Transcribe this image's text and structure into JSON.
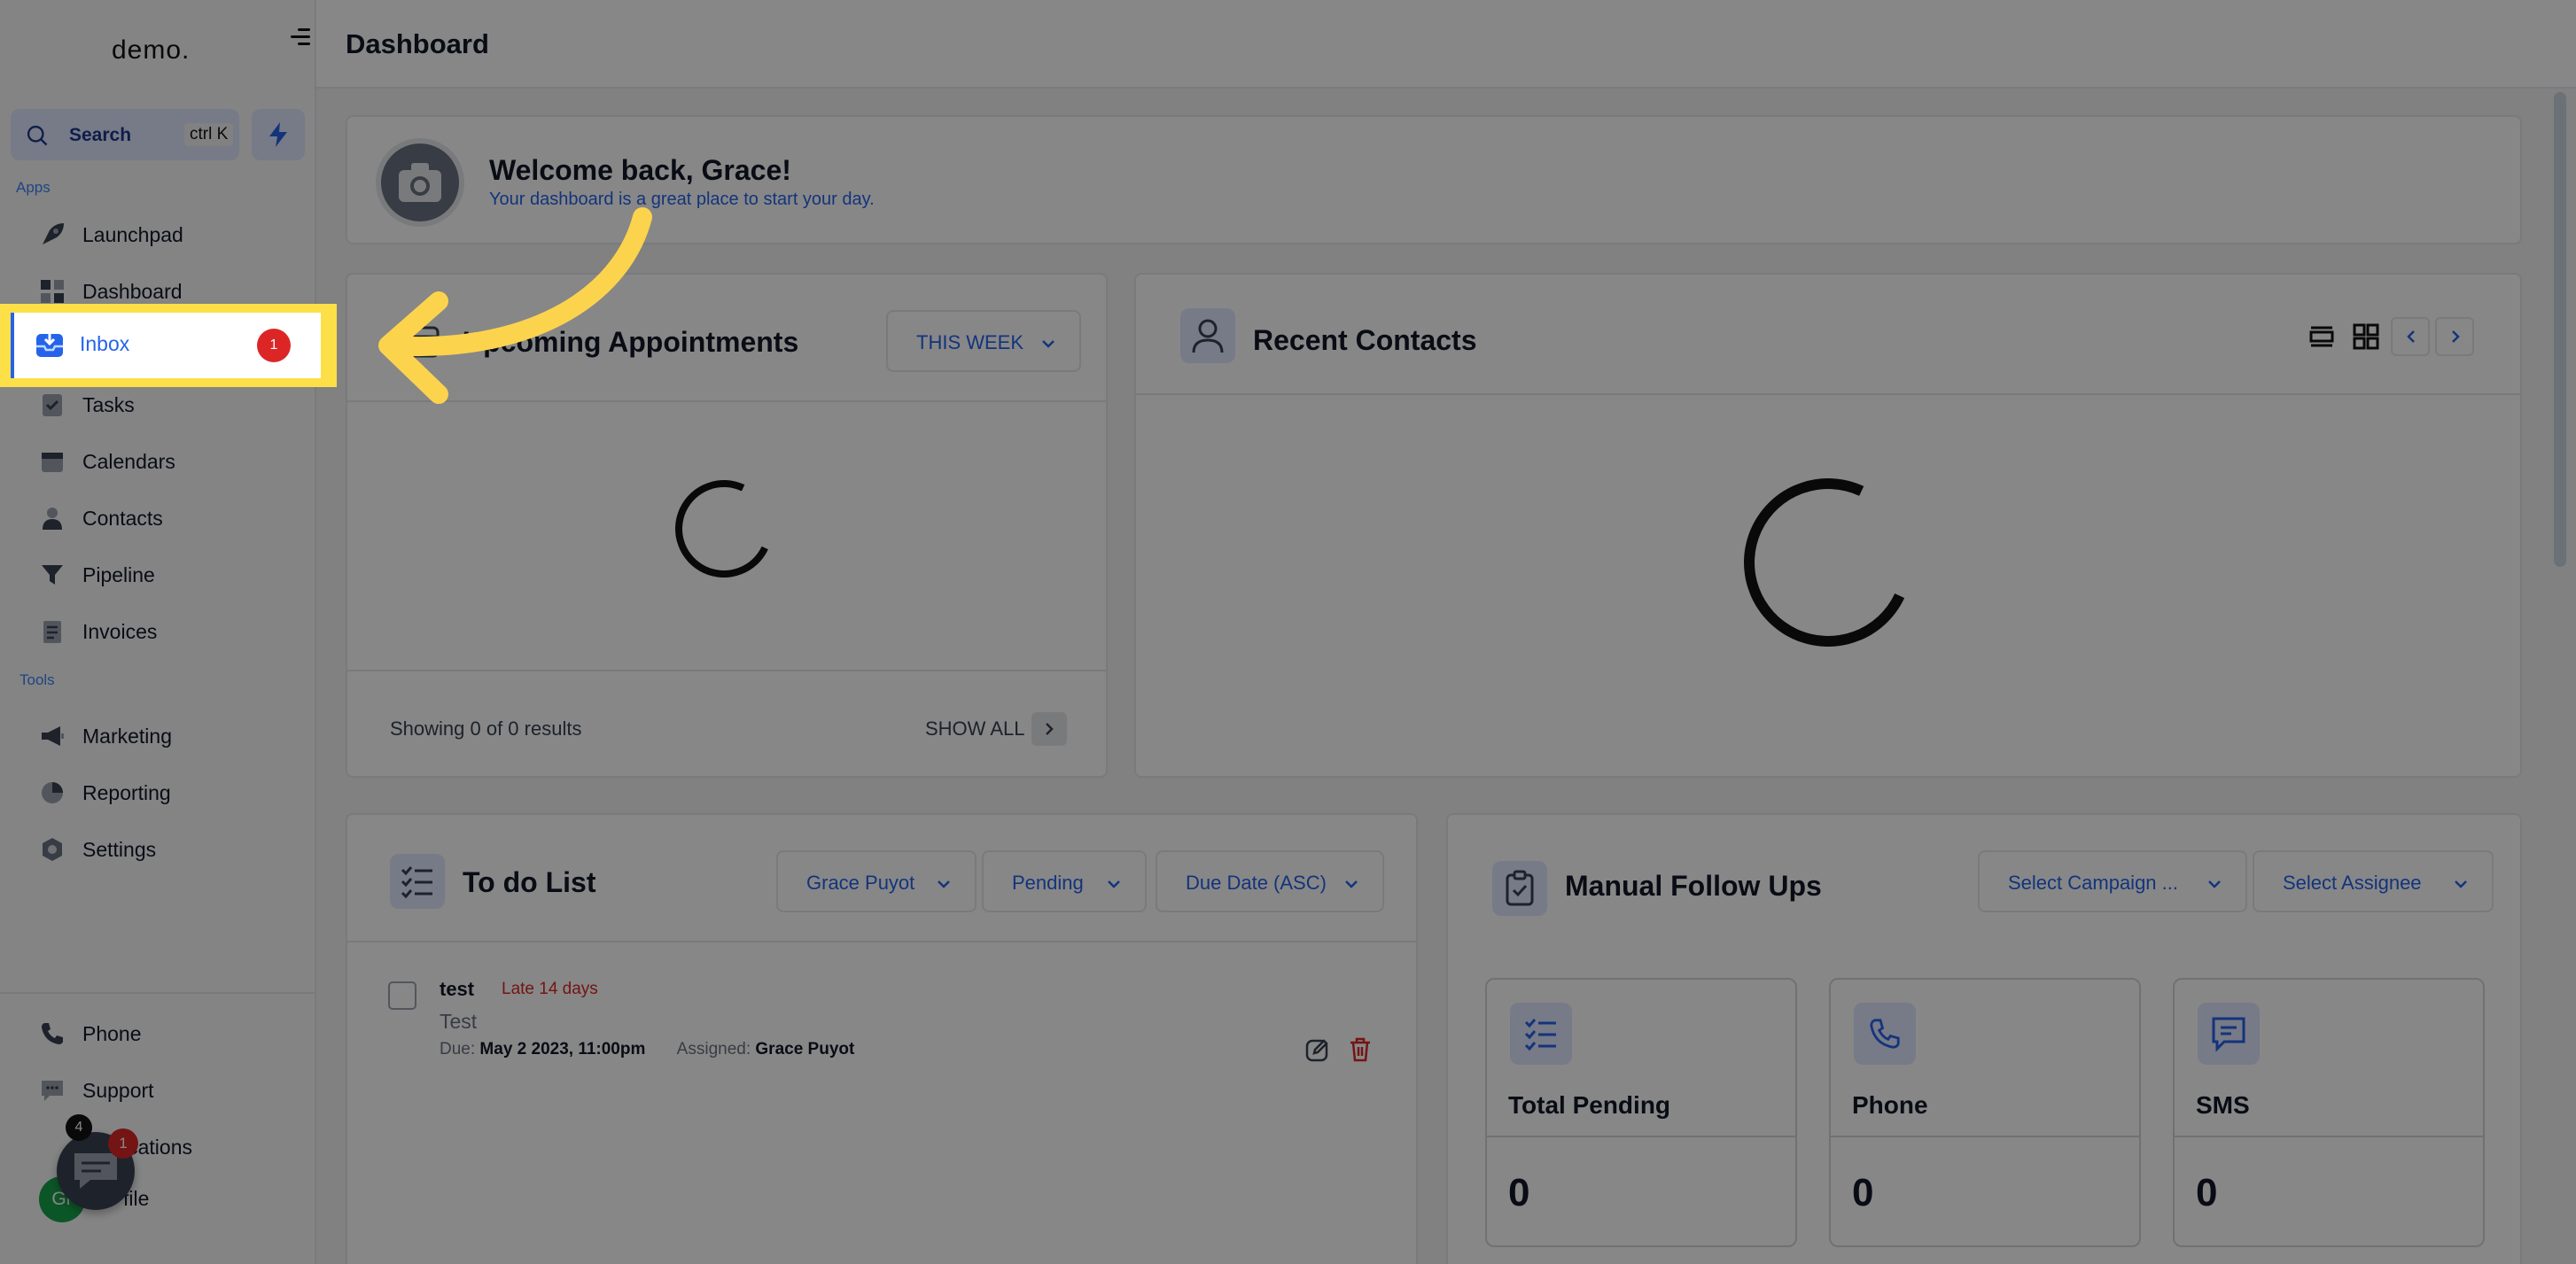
{
  "app": {
    "logo": "demo."
  },
  "search": {
    "label": "Search",
    "shortcut": "ctrl K"
  },
  "sidebar": {
    "section_apps": "Apps",
    "section_tools": "Tools",
    "items": [
      {
        "label": "Launchpad"
      },
      {
        "label": "Dashboard"
      },
      {
        "label": "Inbox",
        "badge": "1"
      },
      {
        "label": "Tasks"
      },
      {
        "label": "Calendars"
      },
      {
        "label": "Contacts"
      },
      {
        "label": "Pipeline"
      },
      {
        "label": "Invoices"
      },
      {
        "label": "Marketing"
      },
      {
        "label": "Reporting"
      },
      {
        "label": "Settings"
      }
    ],
    "bottom": [
      {
        "label": "Phone"
      },
      {
        "label": "Support"
      },
      {
        "label": "ications"
      },
      {
        "label": "file"
      }
    ],
    "notif_count": "4",
    "chat_badge": "1",
    "avatar_initials": "Gr"
  },
  "header": {
    "title": "Dashboard"
  },
  "welcome": {
    "title": "Welcome back, Grace!",
    "subtitle": "Your dashboard is a great place to start your day."
  },
  "appointments": {
    "title": "Upcoming Appointments",
    "range": "THIS WEEK",
    "showing": "Showing 0 of 0 results",
    "show_all": "SHOW ALL"
  },
  "contacts": {
    "title": "Recent Contacts"
  },
  "todo": {
    "title": "To do List",
    "filters": [
      "Grace Puyot",
      "Pending",
      "Due Date (ASC)"
    ],
    "task": {
      "name": "test",
      "status": "Late 14 days",
      "description": "Test",
      "due_label": "Due:",
      "due": "May 2 2023, 11:00pm",
      "assigned_label": "Assigned:",
      "assigned": "Grace Puyot"
    }
  },
  "followups": {
    "title": "Manual Follow Ups",
    "filters": [
      "Select Campaign ...",
      "Select Assignee"
    ],
    "stats": [
      {
        "label": "Total Pending",
        "value": "0"
      },
      {
        "label": "Phone",
        "value": "0"
      },
      {
        "label": "SMS",
        "value": "0"
      }
    ]
  },
  "colors": {
    "accent": "#2563eb",
    "highlight": "#fde047",
    "danger": "#dc2626"
  }
}
